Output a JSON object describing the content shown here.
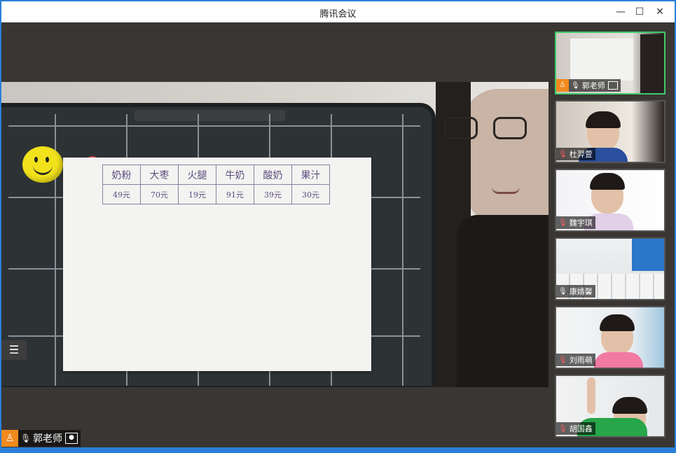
{
  "window": {
    "title": "腾讯会议"
  },
  "main": {
    "speaker_name": "郭老师",
    "paper_table": {
      "headers": [
        "奶粉",
        "大枣",
        "火腿",
        "牛奶",
        "酸奶",
        "果汁"
      ],
      "values": [
        "49元",
        "70元",
        "19元",
        "91元",
        "39元",
        "30元"
      ]
    }
  },
  "participants": [
    {
      "name": "郭老师",
      "muted": false,
      "host": true
    },
    {
      "name": "杜羿萱",
      "muted": true
    },
    {
      "name": "魏宇琪",
      "muted": true
    },
    {
      "name": "康婧馨",
      "muted": false
    },
    {
      "name": "刘雨萌",
      "muted": true
    },
    {
      "name": "胡国鑫",
      "muted": true
    }
  ],
  "colors": {
    "active_border": "#3ecb6a",
    "avatar_bg": "#f08a1e",
    "muted": "#ff5c5c"
  }
}
